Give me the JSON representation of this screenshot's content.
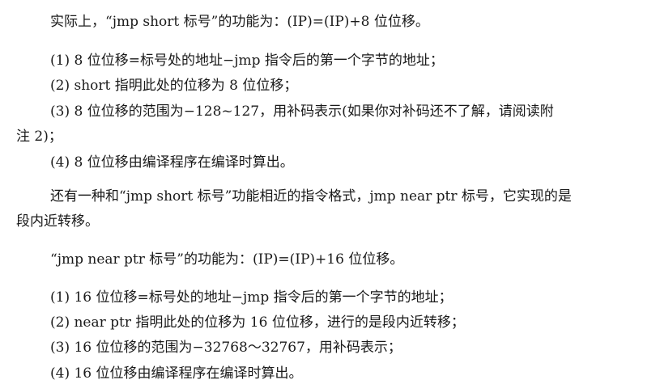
{
  "document": {
    "intro": "实际上，“jmp short 标号”的功能为：(IP)=(IP)+8 位位移。",
    "short_notes": [
      "(1)   8 位位移=标号处的地址−jmp 指令后的第一个字节的地址；",
      "(2)   short 指明此处的位移为 8 位位移；",
      "(3)   8 位位移的范围为−128~127，用补码表示(如果你对补码还不了解，请阅读附",
      "注 2)；",
      "(4)   8 位位移由编译程序在编译时算出。"
    ],
    "near_paragraph": [
      "还有一种和“jmp short 标号”功能相近的指令格式，jmp near ptr 标号，它实现的是",
      "段内近转移。"
    ],
    "near_function": "“jmp near ptr 标号”的功能为：(IP)=(IP)+16 位位移。",
    "near_notes": [
      "(1)   16 位位移=标号处的地址−jmp 指令后的第一个字节的地址；",
      "(2)   near ptr 指明此处的位移为 16 位位移，进行的是段内近转移；",
      "(3)   16 位位移的范围为−32768～32767，用补码表示；",
      "(4)   16 位位移由编译程序在编译时算出。"
    ]
  }
}
